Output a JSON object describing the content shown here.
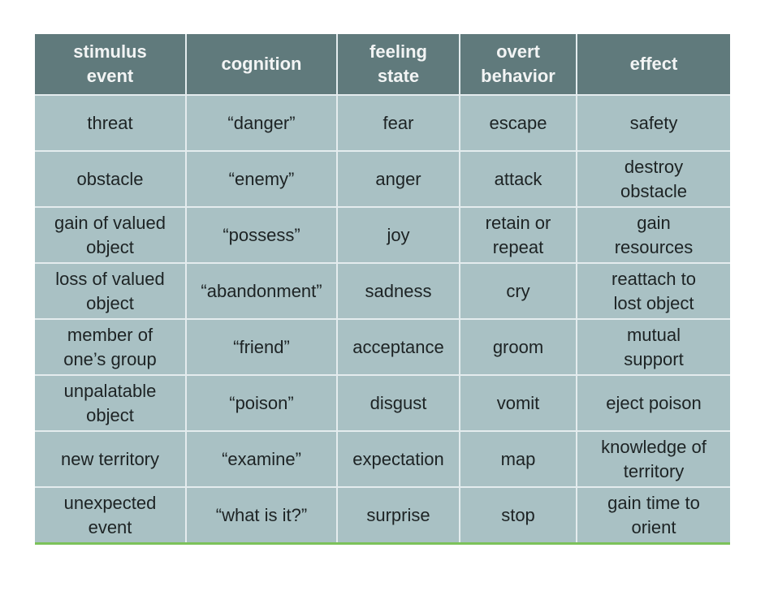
{
  "colors": {
    "header_bg": "#607a7c",
    "body_bg": "#a9c1c4",
    "bottom_rule": "#7cc25a"
  },
  "headers": [
    "stimulus event",
    "cognition",
    "feeling state",
    "overt behavior",
    "effect"
  ],
  "rows": [
    [
      "threat",
      "“danger”",
      "fear",
      "escape",
      "safety"
    ],
    [
      "obstacle",
      "“enemy”",
      "anger",
      "attack",
      "destroy obstacle"
    ],
    [
      "gain of valued object",
      "“possess”",
      "joy",
      "retain or repeat",
      "gain resources"
    ],
    [
      "loss of valued object",
      "“abandonment”",
      "sadness",
      "cry",
      "reattach to lost object"
    ],
    [
      "member of one’s group",
      "“friend”",
      "acceptance",
      "groom",
      "mutual support"
    ],
    [
      "unpalatable object",
      "“poison”",
      "disgust",
      "vomit",
      "eject poison"
    ],
    [
      "new territory",
      "“examine”",
      "expectation",
      "map",
      "knowledge of territory"
    ],
    [
      "unexpected event",
      "“what is it?”",
      "surprise",
      "stop",
      "gain time to orient"
    ]
  ]
}
